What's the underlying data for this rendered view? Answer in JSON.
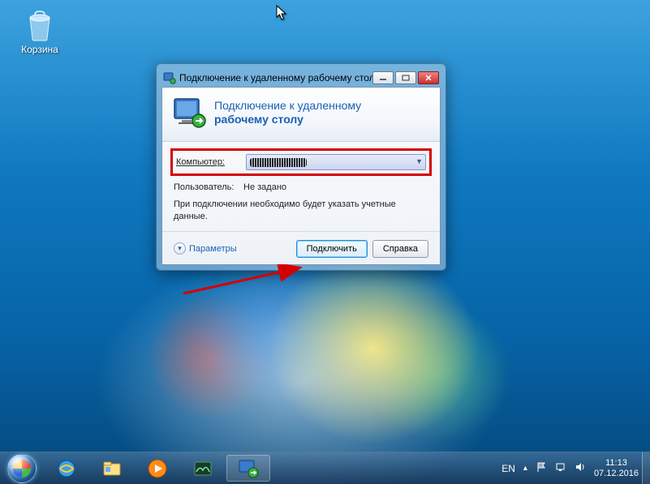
{
  "desktop": {
    "recycle_bin": "Корзина"
  },
  "window": {
    "title": "Подключение к удаленному рабочему столу",
    "banner_line1": "Подключение к удаленному",
    "banner_line2": "рабочему столу",
    "computer_label": "Компьютер:",
    "computer_value": "",
    "user_label": "Пользователь:",
    "user_value": "Не задано",
    "note": "При подключении необходимо будет указать учетные данные.",
    "options": "Параметры",
    "connect": "Подключить",
    "help": "Справка"
  },
  "taskbar": {
    "lang": "EN",
    "time": "11:13",
    "date": "07.12.2016"
  }
}
